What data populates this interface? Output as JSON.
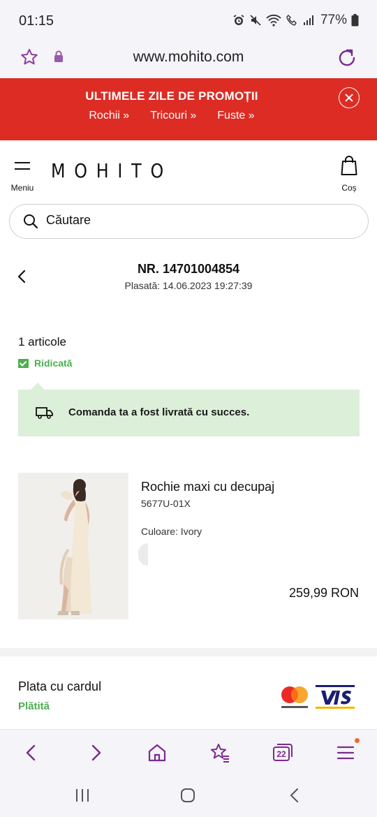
{
  "status_bar": {
    "time": "01:15",
    "battery": "77%"
  },
  "browser": {
    "url": "www.mohito.com"
  },
  "promo": {
    "title": "ULTIMELE ZILE DE PROMOȚII",
    "links": [
      "Rochii »",
      "Tricouri »",
      "Fuste »"
    ]
  },
  "header": {
    "logo": "MOHITO",
    "menu_label": "Meniu",
    "cart_label": "Coș"
  },
  "search": {
    "placeholder": "Căutare"
  },
  "order": {
    "number": "NR. 14701004854",
    "placed": "Plasată: 14.06.2023 19:27:39",
    "item_count": "1 articole",
    "status": "Ridicată",
    "delivery_message": "Comanda ta a fost livrată cu succes."
  },
  "product": {
    "name": "Rochie maxi cu decupaj",
    "sku": "5677U-01X",
    "color": "Culoare: Ivory",
    "price": "259,99 RON"
  },
  "payment": {
    "title": "Plata cu cardul",
    "status": "Plătită",
    "tabs_count": "22"
  },
  "colors": {
    "accent": "#7b2a8f",
    "promo_red": "#dd2c24",
    "success": "#4caf50",
    "success_bg": "#dcefd9"
  }
}
